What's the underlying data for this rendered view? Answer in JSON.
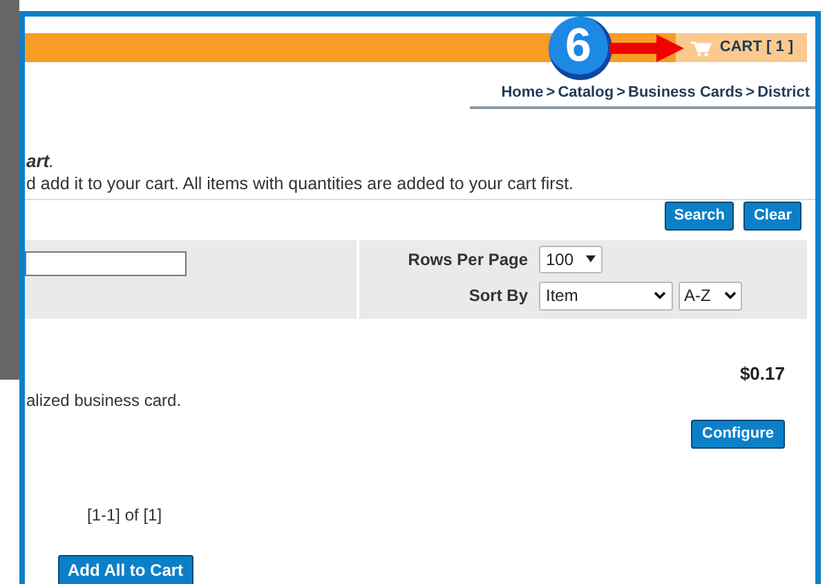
{
  "cart": {
    "label": "CART [ 1 ]"
  },
  "annotation": {
    "label": "6"
  },
  "breadcrumb": {
    "separator": ">",
    "items": [
      "Home",
      "Catalog",
      "Business Cards",
      "District"
    ]
  },
  "intro": {
    "title": "**art**.",
    "text": "d add it to your cart. All items with quantities are added to your cart first."
  },
  "search_buttons": [
    "Search",
    "Clear"
  ],
  "filters": {
    "rows_per_page": {
      "label": "Rows Per Page",
      "value": "100"
    },
    "sort_by": {
      "label": "Sort By",
      "field": "Item",
      "order": "A-Z"
    }
  },
  "item": {
    "price": "$0.17",
    "description": "alized business card.",
    "button": "Configure"
  },
  "pagination": "[1-1] of [1]",
  "add_all_button": "Add All to Cart"
}
